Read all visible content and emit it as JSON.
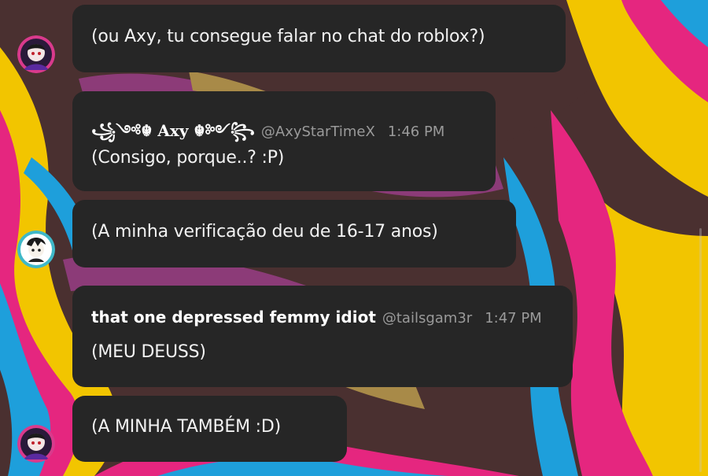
{
  "colors": {
    "bubble": "#262626",
    "text": "#f2f2f2",
    "meta": "#9a9a9a",
    "bg_yellow": "#f2c500",
    "bg_pink": "#e5267f",
    "bg_blue": "#1e9fdb",
    "bg_dark": "#4a3030",
    "bg_purple": "#8c3b78",
    "bg_tan": "#a88a48"
  },
  "messages": [
    {
      "text": "(ou Axy, tu consegue falar no chat do roblox?)"
    },
    {
      "name": "꧁༺☬ Axy ☬༻꧂",
      "handle": "@AxyStarTimeX",
      "time": "1:46 PM",
      "text": "(Consigo, porque..? :P)"
    },
    {
      "text": "(A minha verificação deu de 16-17 anos)"
    },
    {
      "name": "that one depressed femmy idiot",
      "handle": "@tailsgam3r",
      "time": "1:47 PM",
      "text": "(MEU DEUSS)"
    },
    {
      "text": "(A MINHA TAMBÉM :D)"
    }
  ],
  "avatars": [
    {
      "icon": "user-avatar-icon",
      "user": "tailsgam3r"
    },
    {
      "icon": "user-avatar-icon",
      "user": "AxyStarTimeX"
    },
    {
      "icon": "user-avatar-icon",
      "user": "tailsgam3r"
    }
  ]
}
